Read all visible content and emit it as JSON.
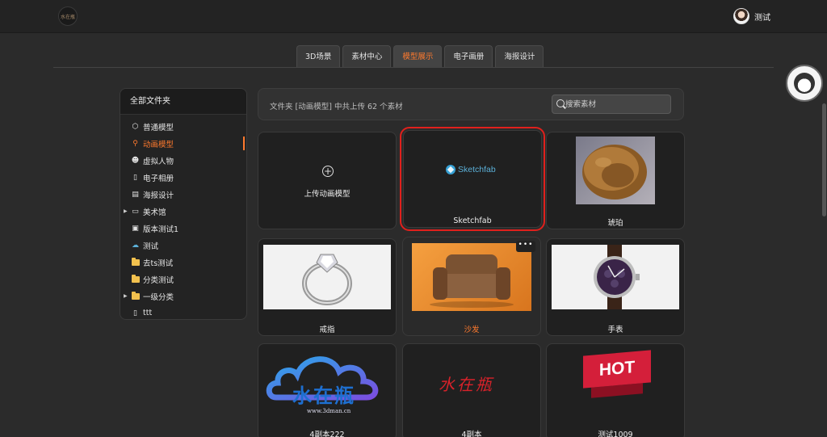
{
  "header": {
    "logo_text": "水在瓶",
    "user_name": "测试"
  },
  "tabs": [
    {
      "label": "3D场景",
      "active": false
    },
    {
      "label": "素材中心",
      "active": false
    },
    {
      "label": "模型展示",
      "active": true
    },
    {
      "label": "电子画册",
      "active": false
    },
    {
      "label": "海报设计",
      "active": false
    }
  ],
  "sidebar": {
    "title": "全部文件夹",
    "items": [
      {
        "label": "普通模型",
        "icon": "cube-icon"
      },
      {
        "label": "动画模型",
        "icon": "animation-icon",
        "active": true
      },
      {
        "label": "虚拟人物",
        "icon": "person-icon"
      },
      {
        "label": "电子相册",
        "icon": "album-icon"
      },
      {
        "label": "海报设计",
        "icon": "poster-icon"
      },
      {
        "label": "美术馆",
        "icon": "gallery-icon",
        "expandable": true
      },
      {
        "label": "版本测试1",
        "icon": "version-icon"
      },
      {
        "label": "测试",
        "icon": "cloud-icon"
      },
      {
        "label": "去ts测试",
        "icon": "folder-icon"
      },
      {
        "label": "分类测试",
        "icon": "folder-icon"
      },
      {
        "label": "一级分类",
        "icon": "folder-icon",
        "expandable": true
      },
      {
        "label": "ttt",
        "icon": "phone-icon"
      }
    ]
  },
  "content": {
    "info_text": "文件夹 [动画模型] 中共上传 62 个素材",
    "search_placeholder": "搜索素材",
    "upload_label": "上传动画模型",
    "upload_plus": "+",
    "more_glyph": "•••",
    "cards": [
      {
        "label": "Sketchfab",
        "logo_text": "Sketchfab"
      },
      {
        "label": "琥珀"
      },
      {
        "label": "戒指"
      },
      {
        "label": "沙发"
      },
      {
        "label": "手表"
      },
      {
        "label": "4副本222",
        "watermark_text": "水在瓶",
        "watermark_url": "www.3dman.cn"
      },
      {
        "label": "4副本",
        "watermark_text": "水在瓶"
      },
      {
        "label": "测试1009",
        "badge_text": "HOT"
      }
    ]
  },
  "colors": {
    "accent": "#ff7a2e",
    "highlight_border": "#e0201c",
    "background": "#2b2b2b"
  }
}
